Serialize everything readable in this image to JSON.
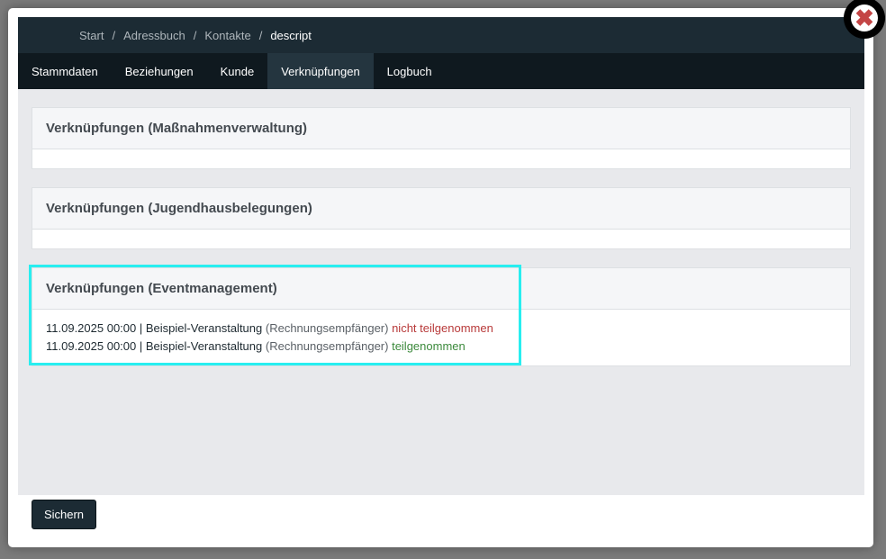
{
  "breadcrumb": {
    "items": [
      "Start",
      "Adressbuch",
      "Kontakte"
    ],
    "current": "descript",
    "separator": "/"
  },
  "tabs": [
    {
      "label": "Stammdaten",
      "active": false
    },
    {
      "label": "Beziehungen",
      "active": false
    },
    {
      "label": "Kunde",
      "active": false
    },
    {
      "label": "Verknüpfungen",
      "active": true
    },
    {
      "label": "Logbuch",
      "active": false
    }
  ],
  "panels": {
    "massnahmen": {
      "title": "Verknüpfungen (Maßnahmenverwaltung)"
    },
    "jugendhaus": {
      "title": "Verknüpfungen (Jugendhausbelegungen)"
    },
    "event": {
      "title": "Verknüpfungen (Eventmanagement)",
      "rows": [
        {
          "datetime": "11.09.2025 00:00",
          "separator": "|",
          "event": "Beispiel-Veranstaltung",
          "role": "(Rechnungsempfänger)",
          "status": "nicht teilgenommen",
          "status_color": "#b83a3a"
        },
        {
          "datetime": "11.09.2025 00:00",
          "separator": "|",
          "event": "Beispiel-Veranstaltung",
          "role": "(Rechnungsempfänger)",
          "status": "teilgenommen",
          "status_color": "#3c8a3c"
        }
      ]
    }
  },
  "footer": {
    "save_label": "Sichern"
  },
  "close": {
    "icon": "close-icon",
    "glyph": "✖"
  },
  "colors": {
    "header": "#1c2b34",
    "tabbar": "#0f191f",
    "highlight": "#28eef0"
  }
}
